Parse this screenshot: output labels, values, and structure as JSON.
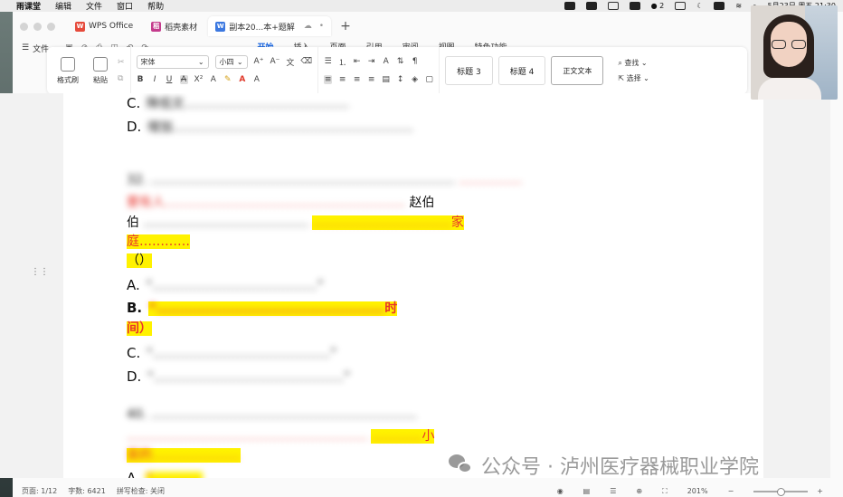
{
  "menubar": {
    "app_name": "雨课堂",
    "items": [
      "编辑",
      "文件",
      "窗口",
      "帮助"
    ],
    "wechat_count": "2",
    "datetime": "5月23日 周五 21:30"
  },
  "tabs": [
    {
      "label": "WPS Office",
      "icon": "wps-icon"
    },
    {
      "label": "稻壳素材",
      "icon": "daoke-icon"
    },
    {
      "label": "副本20...本+题解",
      "icon": "doc-icon"
    }
  ],
  "menu": {
    "file_label": "文件",
    "ribbon_tabs": [
      "开始",
      "插入",
      "页面",
      "引用",
      "审阅",
      "视图",
      "特色功能"
    ],
    "active_tab": "开始"
  },
  "ribbon": {
    "format_painter": "格式刷",
    "paste": "粘贴",
    "font_name": "宋体",
    "font_size": "小四",
    "styles": [
      "标题 3",
      "标题 4",
      "正文文本"
    ],
    "find_label": "查找",
    "select_label": "选择"
  },
  "document": {
    "lines": [
      {
        "prefix": "C.",
        "text": "降低文…………………………………"
      },
      {
        "prefix": "D.",
        "text": "增加…………………………………………………"
      },
      {
        "prefix": "",
        "text": "32. ………………………………………………………………"
      },
      {
        "prefix": "",
        "text": "要有人…………………………………………………"
      },
      {
        "prefix": "伯",
        "text": "…………………………………"
      },
      {
        "prefix": "",
        "text": "庭…………"
      },
      {
        "prefix": "",
        "text": "（）"
      },
      {
        "prefix": "A.",
        "text": "“…………………………………”"
      },
      {
        "prefix": "B.",
        "text": "“………………………………………………"
      },
      {
        "prefix": "",
        "text": "间）"
      },
      {
        "prefix": "C.",
        "text": "“……………………………………”"
      },
      {
        "prefix": "D.",
        "text": "“………………………………………”"
      },
      {
        "prefix": "",
        "text": "40. ………………………………………………………"
      },
      {
        "prefix": "",
        "text": "…………………………………………………"
      },
      {
        "prefix": "",
        "text": "吴的…………………"
      },
      {
        "prefix": "A.",
        "text": "“…………"
      }
    ],
    "visible_words": {
      "zhao_bo": "赵伯",
      "jia": "家",
      "time_tail": "时",
      "xiao": "小",
      "wu_de": "吴的",
      "jian": "间）"
    }
  },
  "status": {
    "page": "页面: 1/12",
    "words": "字数: 6421",
    "spell": "拼写检查: 关闭",
    "zoom": "201%"
  },
  "watermark": "公众号 · 泸州医疗器械职业学院",
  "colors": {
    "accent": "#1a66e0",
    "highlight": "#fff200",
    "red_text": "#e8342c"
  }
}
